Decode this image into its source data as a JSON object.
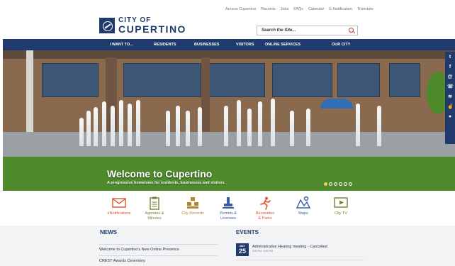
{
  "utility_links": [
    "Access Cupertino",
    "Records",
    "Jobs",
    "FAQs",
    "Calendar",
    "E-Notification",
    "Translate"
  ],
  "logo": {
    "line1": "CITY OF",
    "line2": "CUPERTINO"
  },
  "search": {
    "placeholder": "Search the Site..."
  },
  "nav": [
    "I WANT TO...",
    "RESIDENTS",
    "BUSINESSES",
    "VISITORS",
    "ONLINE SERVICES",
    "OUR CITY"
  ],
  "hero": {
    "title": "Welcome to Cupertino",
    "subtitle": "A progressive hometown for residents, businesses and visitors",
    "slide_count": 6,
    "active_slide": 1
  },
  "social_icons": [
    "twitter-icon",
    "facebook-icon",
    "email-icon",
    "phone-icon",
    "rss-icon",
    "thumbs-up-icon",
    "pin-icon"
  ],
  "quick_links": [
    {
      "label_line1": "eNotifications",
      "label_line2": "",
      "icon": "envelope-icon",
      "color": "#d9542b"
    },
    {
      "label_line1": "Agendas &",
      "label_line2": "Minutes",
      "icon": "clipboard-icon",
      "color": "#7a7f2e"
    },
    {
      "label_line1": "City Records",
      "label_line2": "",
      "icon": "records-icon",
      "color": "#b6862c"
    },
    {
      "label_line1": "Permits &",
      "label_line2": "Licenses",
      "icon": "stamp-icon",
      "color": "#3a5da8"
    },
    {
      "label_line1": "Recreation",
      "label_line2": "& Parks",
      "icon": "runner-icon",
      "color": "#d9542b"
    },
    {
      "label_line1": "Maps",
      "label_line2": "",
      "icon": "map-icon",
      "color": "#3a5da8"
    },
    {
      "label_line1": "City TV",
      "label_line2": "",
      "icon": "tv-icon",
      "color": "#7a7f2e"
    }
  ],
  "news": {
    "title": "NEWS",
    "items": [
      "Welcome to Cupertino's New Online Presence",
      "CREST Awards Ceremony"
    ]
  },
  "events": {
    "title": "EVENTS",
    "items": [
      {
        "month": "MAY",
        "day": "25",
        "name": "Administrative Hearing meeting - Cancelled",
        "time": "5:00 PM - 6:00 PM"
      }
    ]
  },
  "colors": {
    "brand": "#1f3a6b",
    "accent": "#d9542b",
    "link_red": "#c0392b"
  }
}
